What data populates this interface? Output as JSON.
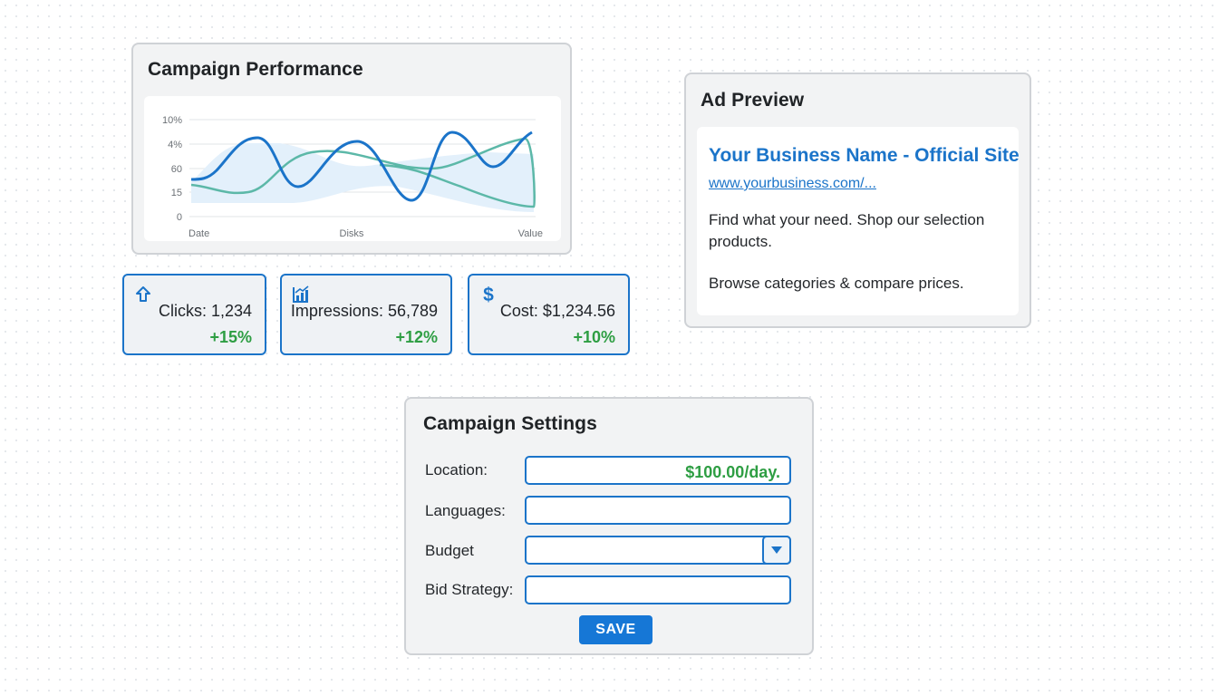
{
  "performance": {
    "title": "Campaign Performance",
    "chart_data": {
      "type": "line",
      "y_tick_labels": [
        "10%",
        "4%",
        "60",
        "15",
        "0"
      ],
      "x_labels": [
        "Date",
        "Disks",
        "Value"
      ],
      "colors": {
        "series_primary": "#1b74c9",
        "series_secondary": "#5cb8a8",
        "band": "#e3f0fb"
      }
    }
  },
  "stats": [
    {
      "icon": "arrow-up-icon",
      "label": "Clicks: 1,234",
      "delta": "+15%"
    },
    {
      "icon": "bar-chart-icon",
      "label": "Impressions: 56,789",
      "delta": "+12%"
    },
    {
      "icon": "dollar-icon",
      "label": "Cost: $1,234.56",
      "delta": "+10%"
    }
  ],
  "ad_preview": {
    "title": "Ad Preview",
    "headline": "Your Business Name - Official Site",
    "url": "www.yourbusiness.com/...",
    "description_1": "Find what your need. Shop our selection products.",
    "description_2": "Browse categories & compare prices."
  },
  "settings": {
    "title": "Campaign Settings",
    "fields": [
      {
        "label": "Location:",
        "value": "$100.00/day."
      },
      {
        "label": "Languages:",
        "value": ""
      },
      {
        "label": "Budget",
        "value": ""
      },
      {
        "label": "Bid Strategy:",
        "value": ""
      }
    ],
    "save_label": "SAVE"
  },
  "colors": {
    "accent": "#1b74c9",
    "positive": "#2e9e43"
  }
}
